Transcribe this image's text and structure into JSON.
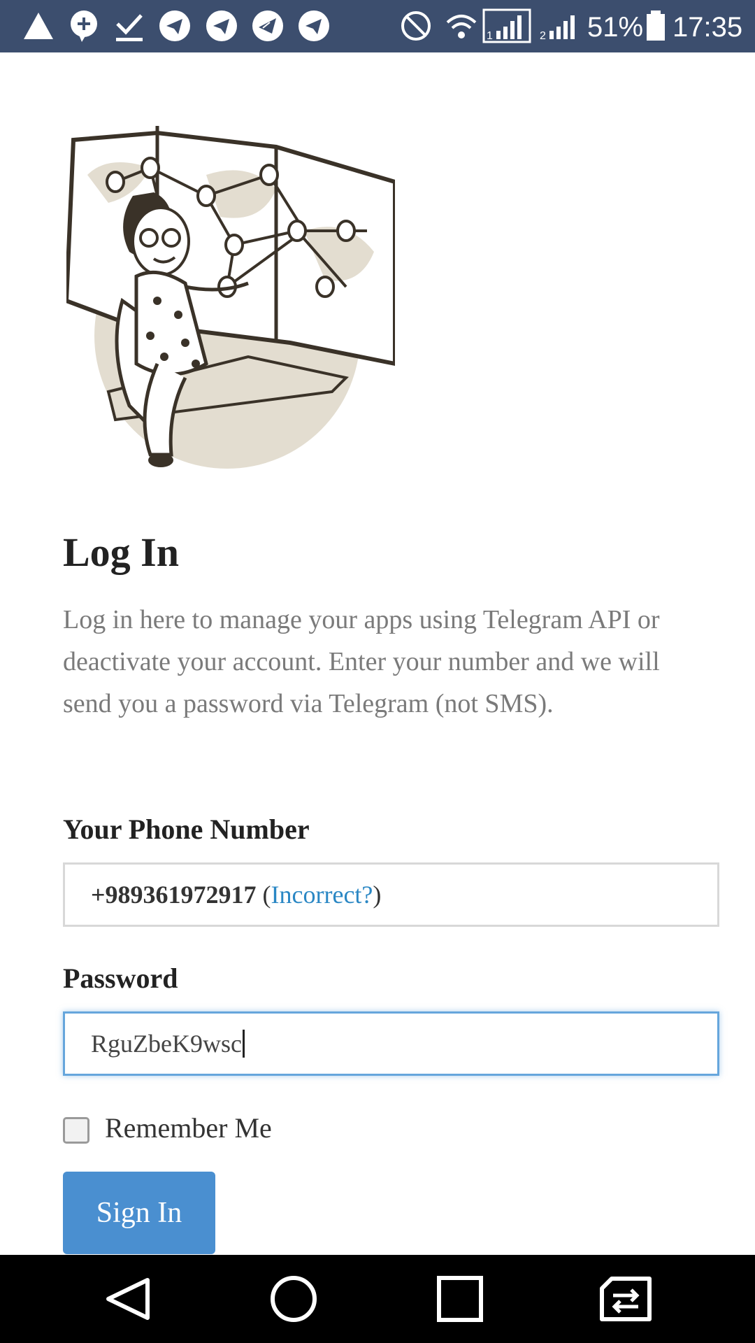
{
  "status_bar": {
    "battery_percent": "51%",
    "time": "17:35",
    "sim1_label": "1",
    "sim2_label": "2",
    "notification_icons": [
      "alert-triangle-icon",
      "plus-bubble-icon",
      "download-icon",
      "telegram-icon",
      "telegram-icon",
      "telegram-x-icon",
      "telegram-icon"
    ],
    "system_icons": [
      "do-not-disturb-icon",
      "wifi-icon",
      "signal-sim1-icon",
      "signal-sim2-icon",
      "battery-icon"
    ]
  },
  "page": {
    "title": "Log In",
    "intro_text": "Log in here to manage your apps using Telegram API or deactivate your account. Enter your number and we will send you a password via Telegram (not SMS)."
  },
  "phone": {
    "label": "Your Phone Number",
    "value": "+989361972917",
    "open_paren": " (",
    "incorrect_link": "Incorrect?",
    "close_paren": ")"
  },
  "password": {
    "label": "Password",
    "value": "RguZbeK9wsc"
  },
  "remember": {
    "label": "Remember Me",
    "checked": false
  },
  "signin": {
    "label": "Sign In",
    "color": "#4a8fd0"
  },
  "nav_bar": {
    "buttons": [
      "back-icon",
      "home-icon",
      "recents-icon",
      "switch-sim-icon"
    ]
  },
  "colors": {
    "status_bar": "#3c4e6e",
    "link": "#2a87c4",
    "focus_border": "#66a6dc"
  }
}
